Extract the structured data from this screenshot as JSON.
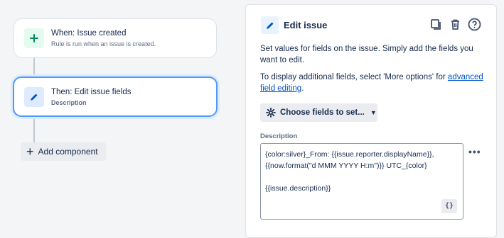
{
  "flow": {
    "trigger": {
      "title": "When: Issue created",
      "subtitle": "Rule is run when an issue is created."
    },
    "action": {
      "title": "Then: Edit issue fields",
      "subtitle": "Description"
    },
    "add_component_label": "Add component"
  },
  "panel": {
    "title": "Edit issue",
    "description": "Set values for fields on the issue. Simply add the fields you want to edit.",
    "more_info_prefix": "To display additional fields, select 'More options' for ",
    "more_info_link": "advanced field editing",
    "more_info_suffix": ".",
    "choose_fields_label": "Choose fields to set...",
    "field_label": "Description",
    "field_value_lines": [
      "{color:silver}_From: {{issue.reporter.displayName}},",
      "{{now.format(\"d MMM YYYY H:m\")}} UTC_{color}",
      "",
      "{{issue.description}}"
    ],
    "smart_values_button": "{}",
    "more_options": "•••"
  },
  "colors": {
    "trigger_icon_bg": "#e3fcef",
    "trigger_icon_fg": "#00875a",
    "action_icon_bg": "#deebff",
    "action_icon_fg": "#0052cc",
    "selected_border": "#4c9aff",
    "link": "#0052cc"
  }
}
